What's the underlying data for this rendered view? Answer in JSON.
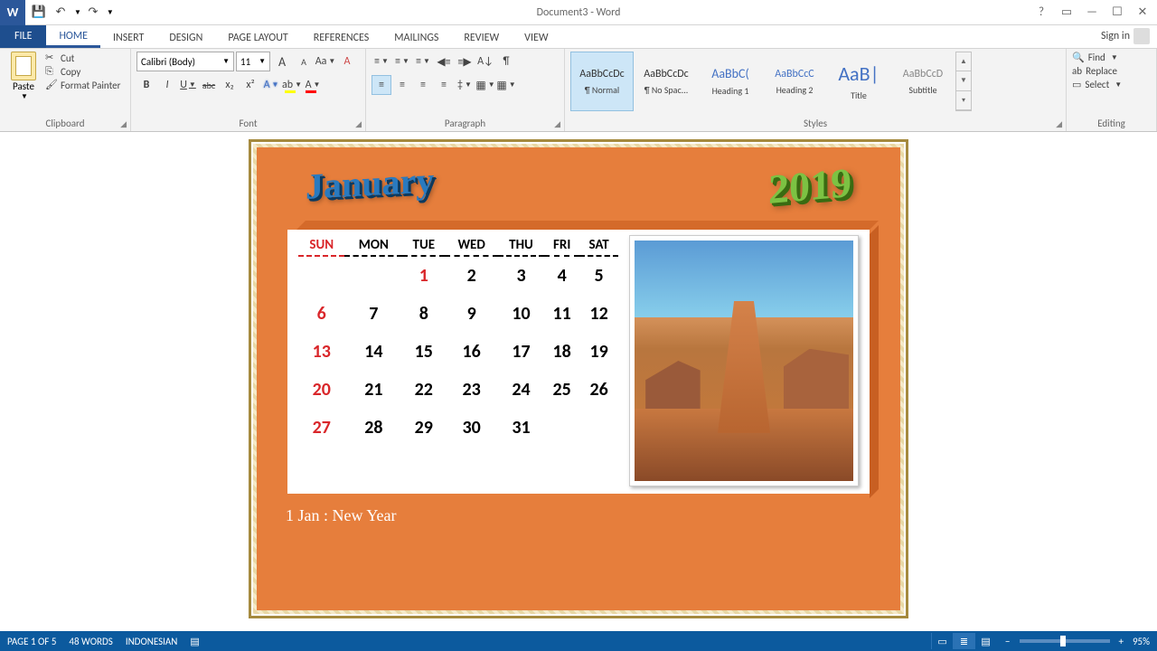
{
  "title": "Document3 - Word",
  "qat": {
    "save": "💾",
    "undo": "↶",
    "redo": "↷"
  },
  "winctrl": {
    "help": "?",
    "opts": "▭",
    "min": "—",
    "max": "☐",
    "close": "✕"
  },
  "tabs": {
    "file": "FILE",
    "home": "HOME",
    "insert": "INSERT",
    "design": "DESIGN",
    "layout": "PAGE LAYOUT",
    "references": "REFERENCES",
    "mailings": "MAILINGS",
    "review": "REVIEW",
    "view": "VIEW"
  },
  "signin": "Sign in",
  "clipboard": {
    "paste": "Paste",
    "cut": "Cut",
    "copy": "Copy",
    "fmt": "Format Painter",
    "label": "Clipboard"
  },
  "font": {
    "name": "Calibri (Body)",
    "size": "11",
    "grow": "A",
    "shrink": "A",
    "case": "Aa",
    "clear": "A",
    "b": "B",
    "i": "I",
    "u": "U",
    "strike": "abc",
    "sub": "x₂",
    "sup": "x²",
    "fx": "A",
    "hl": "ab",
    "color": "A",
    "label": "Font"
  },
  "para": {
    "label": "Paragraph"
  },
  "styles": {
    "label": "Styles",
    "items": [
      {
        "prev": "AaBbCcDc",
        "name": "¶ Normal"
      },
      {
        "prev": "AaBbCcDc",
        "name": "¶ No Spac..."
      },
      {
        "prev": "AaBbC(",
        "name": "Heading 1"
      },
      {
        "prev": "AaBbCcC",
        "name": "Heading 2"
      },
      {
        "prev": "AaB|",
        "name": "Title"
      },
      {
        "prev": "AaBbCcD",
        "name": "Subtitle"
      }
    ]
  },
  "editing": {
    "find": "Find",
    "replace": "Replace",
    "select": "Select",
    "label": "Editing"
  },
  "calendar": {
    "month": "January",
    "year": "2019",
    "days": [
      "SUN",
      "MON",
      "TUE",
      "WED",
      "THU",
      "FRI",
      "SAT"
    ],
    "weeks": [
      [
        "",
        "",
        "1",
        "2",
        "3",
        "4",
        "5"
      ],
      [
        "6",
        "7",
        "8",
        "9",
        "10",
        "11",
        "12"
      ],
      [
        "13",
        "14",
        "15",
        "16",
        "17",
        "18",
        "19"
      ],
      [
        "20",
        "21",
        "22",
        "23",
        "24",
        "25",
        "26"
      ],
      [
        "27",
        "28",
        "29",
        "30",
        "31",
        "",
        ""
      ]
    ],
    "note": "1 Jan : New Year"
  },
  "status": {
    "page": "PAGE 1 OF 5",
    "words": "48 WORDS",
    "lang": "INDONESIAN",
    "zoom": "95%"
  }
}
